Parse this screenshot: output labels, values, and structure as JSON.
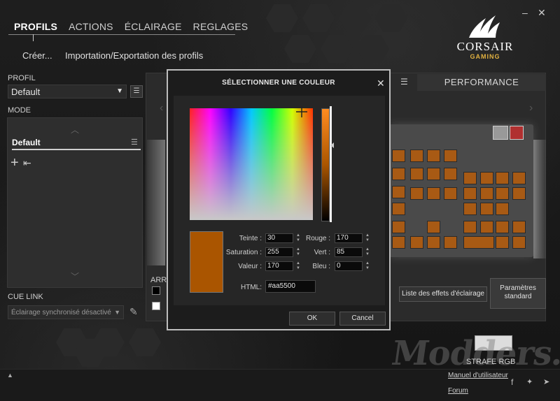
{
  "window": {
    "minimize": "–",
    "close": "✕"
  },
  "tabs": [
    {
      "label": "PROFILS"
    },
    {
      "label": "ACTIONS"
    },
    {
      "label": "ÉCLAIRAGE"
    },
    {
      "label": "REGLAGES"
    }
  ],
  "logo": {
    "name": "CORSAIR",
    "sub": "GAMING"
  },
  "subnav": {
    "create": "Créer...",
    "import_export": "Importation/Exportation des profils"
  },
  "left": {
    "profil_label": "PROFIL",
    "profil_value": "Default",
    "mode_label": "MODE",
    "mode_item": "Default",
    "cue_link_label": "CUE LINK",
    "cue_link_value": "Éclairage synchronisé désactivé",
    "arr_label": "ARR"
  },
  "center": {
    "perf_header": "PERFORMANCE",
    "btn_effects": "Liste des effets d'éclairage",
    "btn_params": "Paramètres standard"
  },
  "dialog": {
    "title": "SÉLECTIONNER UNE COULEUR",
    "close": "✕",
    "fields": {
      "teinte_label": "Teinte :",
      "teinte_value": "30",
      "saturation_label": "Saturation :",
      "saturation_value": "255",
      "valeur_label": "Valeur :",
      "valeur_value": "170",
      "rouge_label": "Rouge :",
      "rouge_value": "170",
      "vert_label": "Vert :",
      "vert_value": "85",
      "bleu_label": "Bleu :",
      "bleu_value": "0",
      "html_label": "HTML:",
      "html_value": "#aa5500"
    },
    "ok": "OK",
    "cancel": "Cancel",
    "selected_color": "#aa5500"
  },
  "bottom": {
    "device": "STRAFE RGB",
    "manual": "Manuel d'utilisateur",
    "forum": "Forum",
    "watermark": "Modders.fr"
  }
}
